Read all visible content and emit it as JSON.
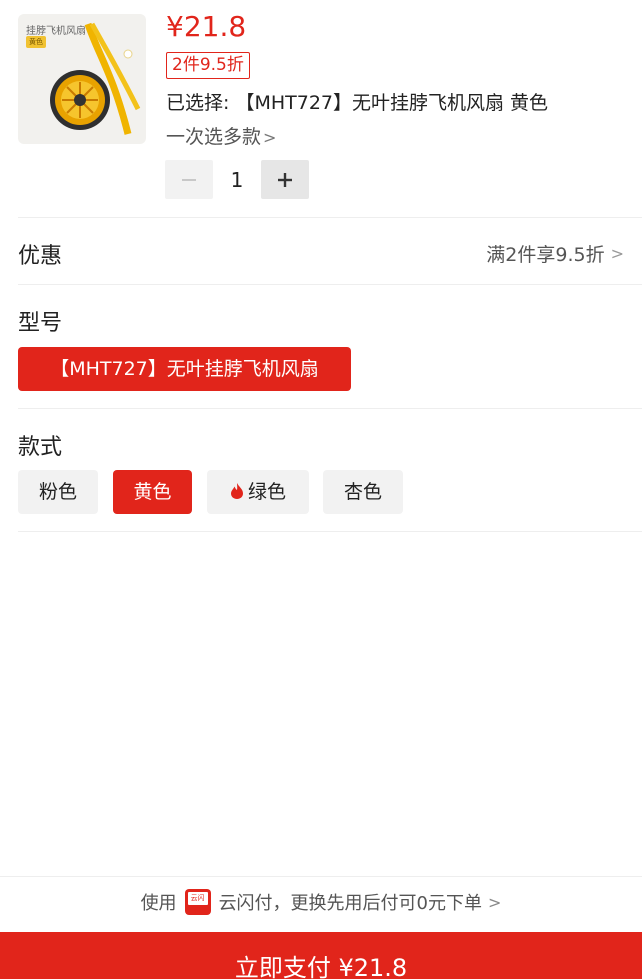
{
  "product": {
    "image_caption": "挂脖飞机风扇",
    "image_tag": "黄色",
    "price": "¥21.8",
    "discount_badge": "2件9.5折",
    "selected_text": "已选择: 【MHT727】无叶挂脖飞机风扇 黄色",
    "multi_select_text": "一次选多款",
    "quantity": "1"
  },
  "promo": {
    "label": "优惠",
    "value": "满2件享9.5折"
  },
  "model": {
    "label": "型号",
    "options": [
      "【MHT727】无叶挂脖飞机风扇"
    ],
    "selected_index": 0
  },
  "style": {
    "label": "款式",
    "options": [
      "粉色",
      "黄色",
      "绿色",
      "杏色"
    ],
    "selected_index": 1,
    "hot_index": 2
  },
  "payment": {
    "hint_prefix": "使用",
    "hint_suffix": "云闪付，更换先用后付可0元下单",
    "logo_text": "云闪付",
    "button_label": "立即支付 ¥21.8"
  },
  "colors": {
    "accent": "#e1251b",
    "chip_bg": "#f2f2f2"
  },
  "icons": {
    "minus": "minus-icon",
    "plus": "plus-icon",
    "chevron": "chevron-right-icon",
    "flame": "flame-icon"
  }
}
